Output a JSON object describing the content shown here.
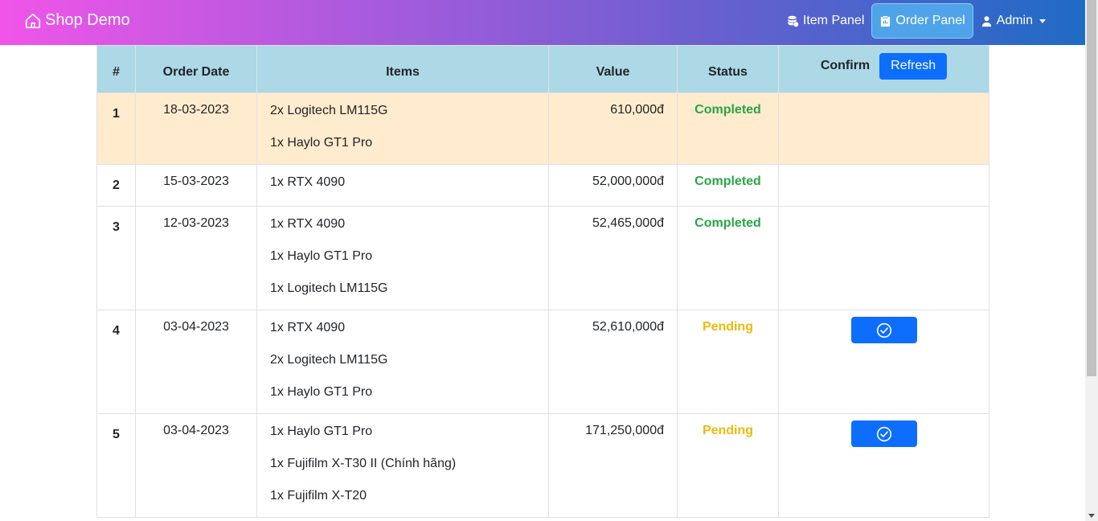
{
  "navbar": {
    "brand": "Shop Demo",
    "brand_icon": "house-icon",
    "links": [
      {
        "label": "Item Panel",
        "icon": "database-icon",
        "active": false
      },
      {
        "label": "Order Panel",
        "icon": "clipboard-icon",
        "active": true
      },
      {
        "label": "Admin",
        "icon": "user-icon",
        "active": false
      }
    ]
  },
  "table": {
    "headers": {
      "num": "#",
      "date": "Order Date",
      "items": "Items",
      "value": "Value",
      "status": "Status",
      "confirm": "Confirm"
    },
    "refresh_label": "Refresh",
    "rows": [
      {
        "num": "1",
        "date": "18-03-2023",
        "items": [
          "2x Logitech LM115G",
          "1x Haylo GT1 Pro"
        ],
        "value": "610,000đ",
        "status": "Completed"
      },
      {
        "num": "2",
        "date": "15-03-2023",
        "items": [
          "1x RTX 4090"
        ],
        "value": "52,000,000đ",
        "status": "Completed"
      },
      {
        "num": "3",
        "date": "12-03-2023",
        "items": [
          "1x RTX 4090",
          "1x Haylo GT1 Pro",
          "1x Logitech LM115G"
        ],
        "value": "52,465,000đ",
        "status": "Completed"
      },
      {
        "num": "4",
        "date": "03-04-2023",
        "items": [
          "1x RTX 4090",
          "2x Logitech LM115G",
          "1x Haylo GT1 Pro"
        ],
        "value": "52,610,000đ",
        "status": "Pending"
      },
      {
        "num": "5",
        "date": "03-04-2023",
        "items": [
          "1x Haylo GT1 Pro",
          "1x Fujifilm X-T30 II (Chính hãng)",
          "1x Fujifilm X-T20"
        ],
        "value": "171,250,000đ",
        "status": "Pending"
      }
    ]
  },
  "colors": {
    "completed": "#28a745",
    "pending": "#f0b90b",
    "header_bg": "#add8e6",
    "highlight_row": "#ffebcd",
    "primary": "#0d6efd"
  }
}
